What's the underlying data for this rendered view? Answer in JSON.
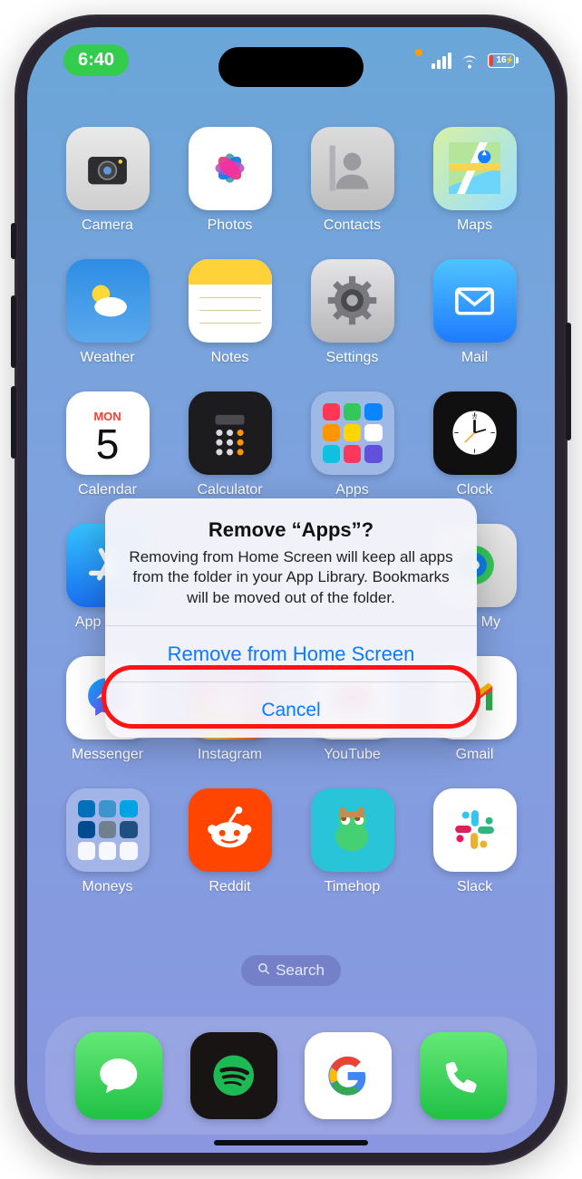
{
  "status": {
    "time": "6:40",
    "battery_percent": "16",
    "charging": true
  },
  "calendar": {
    "weekday": "MON",
    "day": "5"
  },
  "apps": {
    "row1": [
      "Camera",
      "Photos",
      "Contacts",
      "Maps"
    ],
    "row2": [
      "Weather",
      "Notes",
      "Settings",
      "Mail"
    ],
    "row3": [
      "Calendar",
      "Calculator",
      "Apps",
      "Clock"
    ],
    "row4": [
      "App Store",
      "",
      "",
      "Find My"
    ],
    "row5": [
      "Messenger",
      "Instagram",
      "YouTube",
      "Gmail"
    ],
    "row6": [
      "Moneys",
      "Reddit",
      "Timehop",
      "Slack"
    ]
  },
  "search": {
    "label": "Search"
  },
  "dock": [
    "Messages",
    "Spotify",
    "Google",
    "Phone"
  ],
  "alert": {
    "title": "Remove “Apps”?",
    "message": "Removing from Home Screen will keep all apps from the folder in your App Library. Bookmarks will be moved out of the folder.",
    "primary": "Remove from Home Screen",
    "cancel": "Cancel"
  }
}
